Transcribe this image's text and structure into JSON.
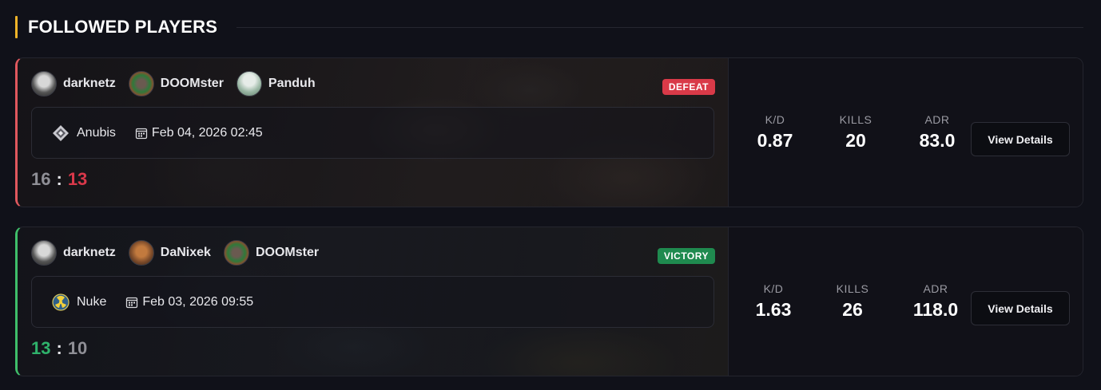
{
  "section": {
    "title": "FOLLOWED PLAYERS",
    "accent_color": "#f0b429"
  },
  "matches": [
    {
      "result": "DEFEAT",
      "result_color": "#d93a48",
      "players": [
        {
          "name": "darknetz",
          "avatar": "avatar-icon"
        },
        {
          "name": "DOOMster",
          "avatar": "avatar-icon"
        },
        {
          "name": "Panduh",
          "avatar": "avatar-icon"
        }
      ],
      "map": {
        "name": "Anubis",
        "icon": "anubis-map-icon"
      },
      "date": "Feb 04, 2026 02:45",
      "score": {
        "team": "16",
        "separator": ":",
        "enemy": "13"
      },
      "stats": [
        {
          "label": "K/D",
          "value": "0.87"
        },
        {
          "label": "KILLS",
          "value": "20"
        },
        {
          "label": "ADR",
          "value": "83.0"
        }
      ],
      "button_label": "View Details"
    },
    {
      "result": "VICTORY",
      "result_color": "#1f8a4f",
      "players": [
        {
          "name": "darknetz",
          "avatar": "avatar-icon"
        },
        {
          "name": "DaNixek",
          "avatar": "avatar-icon"
        },
        {
          "name": "DOOMster",
          "avatar": "avatar-icon"
        }
      ],
      "map": {
        "name": "Nuke",
        "icon": "nuke-map-icon"
      },
      "date": "Feb 03, 2026 09:55",
      "score": {
        "team": "13",
        "separator": ":",
        "enemy": "10"
      },
      "stats": [
        {
          "label": "K/D",
          "value": "1.63"
        },
        {
          "label": "KILLS",
          "value": "26"
        },
        {
          "label": "ADR",
          "value": "118.0"
        }
      ],
      "button_label": "View Details"
    }
  ]
}
